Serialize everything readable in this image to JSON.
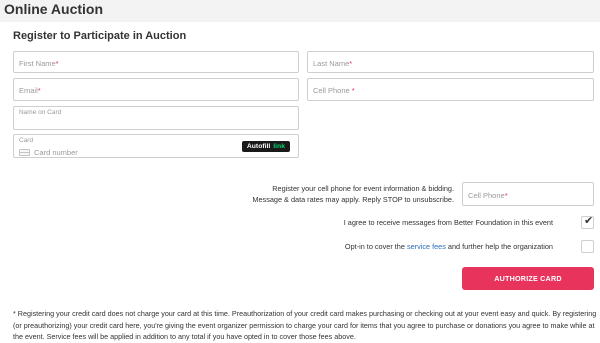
{
  "header": {
    "title": "Online Auction"
  },
  "form": {
    "section_title": "Register to Participate in Auction",
    "first_name_placeholder": "First Name",
    "last_name_placeholder": "Last Name",
    "email_placeholder": "Email",
    "cell_phone_placeholder": "Cell Phone",
    "required_mark": "*",
    "name_on_card_label": "Name on Card",
    "card_label": "Card",
    "card_number_placeholder": "Card number",
    "autofill_label": "Autofill",
    "autofill_link": "link"
  },
  "sms": {
    "line1": "Register your cell phone for event information & bidding.",
    "line2": "Message & data rates may apply. Reply STOP to unsubscribe.",
    "cell_phone_placeholder": "Cell Phone"
  },
  "options": {
    "receive_messages_label": "I agree to receive messages from Better Foundation in this event",
    "receive_messages_checked": true,
    "check_mark": "✔",
    "cover_fees_prefix": "Opt-in to cover the",
    "cover_fees_link": "service fees",
    "cover_fees_suffix": "and further help the organization",
    "cover_fees_checked": false
  },
  "actions": {
    "authorize_label": "AUTHORIZE CARD"
  },
  "disclaimer": "* Registering your credit card does not charge your card at this time. Preauthorization of your credit card makes purchasing or checking out at your event easy and quick. By registering (or preauthorizing) your credit card here, you're giving the event organizer permission to charge your card for items that you agree to purchase or donations you agree to make while at the event. Service fees will be applied in addition to any total if you have opted in to cover those fees above.",
  "colors": {
    "accent": "#e8345c",
    "link": "#2a6fb6",
    "autofill_green": "#00d66f"
  }
}
